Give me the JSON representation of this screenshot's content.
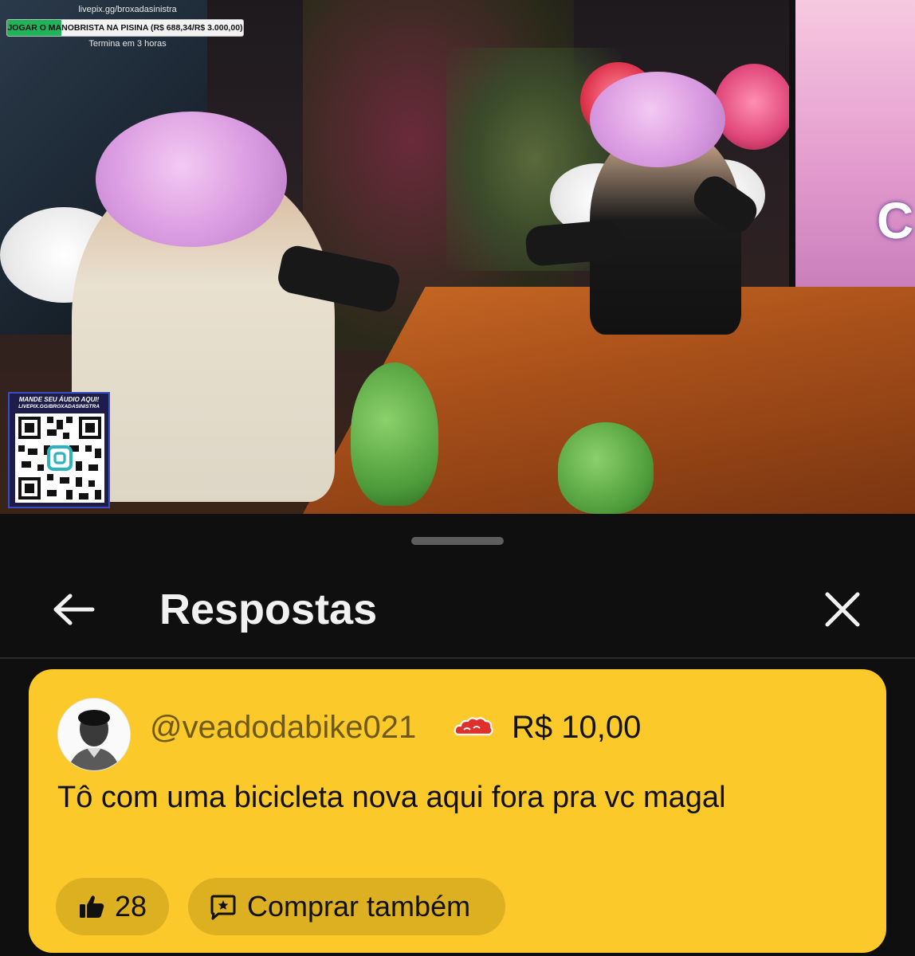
{
  "video": {
    "overlay_link": "livepix.gg/broxadasinistra",
    "goal_text": "JOGAR O MANOBRISTA NA PISINA (R$ 688,34/R$ 3.000,00)",
    "goal_progress": 0.2294,
    "goal_time_left": "Termina em 3 horas",
    "qr_title": "MANDE SEU ÁUDIO AQUI!",
    "qr_subtitle": "LIVEPIX.GG/BROXADASINISTRA",
    "screen_text": "C"
  },
  "sheet": {
    "title": "Respostas",
    "back_icon": "arrow-left-icon",
    "close_icon": "close-icon"
  },
  "comment": {
    "username": "@veadodabike021",
    "badge_icon": "akatsuki-cloud-icon",
    "amount": "R$ 10,00",
    "message": "Tô com uma bicicleta nova aqui fora pra vc magal",
    "likes": "28",
    "buy_label": "Comprar também",
    "card_color": "#fcc92a",
    "pill_color": "#ddb022"
  }
}
